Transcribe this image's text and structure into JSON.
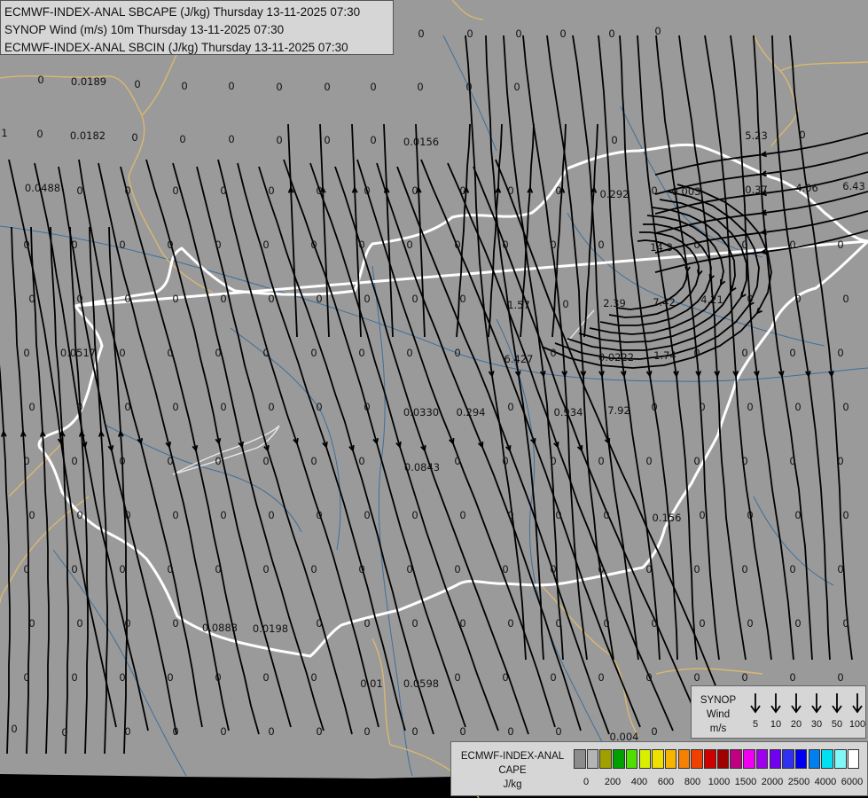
{
  "titles": {
    "line1": "ECMWF-INDEX-ANAL SBCAPE (J/kg) Thursday 13-11-2025 07:30",
    "line2": "SYNOP Wind (m/s) 10m Thursday 13-11-2025 07:30",
    "line3": "ECMWF-INDEX-ANAL SBCIN (J/kg) Thursday 13-11-2025 07:30"
  },
  "map_values": [
    "0",
    "0",
    "0",
    "0",
    "0",
    "0",
    "0",
    "0.0189",
    "0",
    "0",
    "0",
    "0",
    "0",
    "0",
    "0",
    "0",
    "0",
    "1",
    "0",
    "0.0182",
    "0",
    "0",
    "0",
    "0",
    "0",
    "0",
    "0.0156",
    "0",
    "5.23",
    "0",
    "0.0488",
    "0.292",
    "0.003",
    "0.37",
    "4.06",
    "6.43",
    "14.3",
    "1.57",
    "0",
    "2.39",
    "7.42",
    "4.21",
    "0.0517",
    "6.427",
    "0.0222",
    "1.74",
    "0.0330",
    "0.294",
    "0.934",
    "7.92",
    "0.0843",
    "0.156",
    "0.0883",
    "0.0198",
    "0.01",
    "0.0598",
    "0",
    "0",
    "0.004",
    "0"
  ],
  "synop_legend": {
    "title_line1": "SYNOP",
    "title_line2": "Wind",
    "title_line3": "m/s",
    "speeds": [
      "5",
      "10",
      "20",
      "30",
      "50",
      "100"
    ]
  },
  "cape_legend": {
    "title_line1": "ECMWF-INDEX-ANAL",
    "title_line2": "CAPE",
    "title_line3": "J/kg",
    "colors": [
      "#8c8c8c",
      "#b4b4b4",
      "#a0a000",
      "#00a000",
      "#50e000",
      "#d8f000",
      "#f0e000",
      "#f8b400",
      "#f88000",
      "#f04000",
      "#d00000",
      "#a00000",
      "#c00080",
      "#f000f0",
      "#a000f0",
      "#7000f0",
      "#3030f0",
      "#0000f0",
      "#0080f0",
      "#00e0f0",
      "#80f8f8",
      "#ffffff"
    ],
    "ticks": [
      "0",
      "200",
      "400",
      "600",
      "800",
      "1000",
      "1500",
      "2000",
      "2500",
      "4000",
      "6000"
    ]
  }
}
